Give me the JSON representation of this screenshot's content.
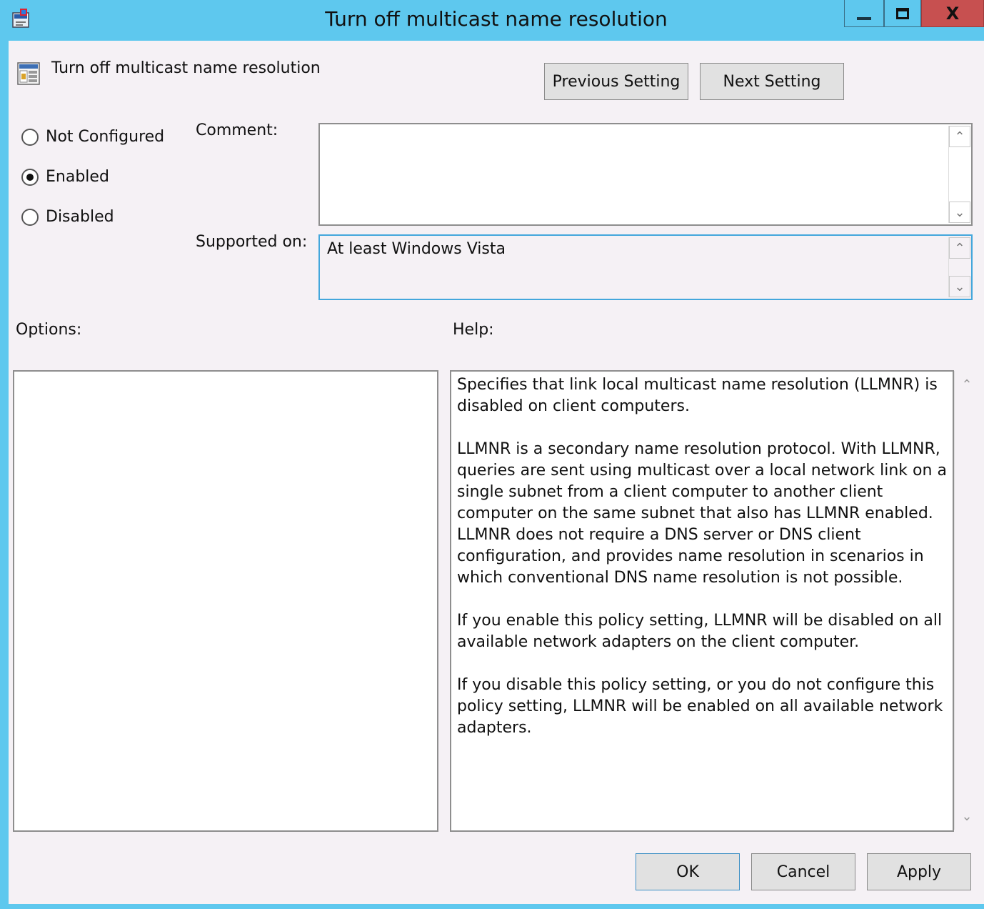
{
  "window": {
    "title": "Turn off multicast name resolution",
    "close_glyph": "X"
  },
  "header": {
    "policy_name": "Turn off multicast name resolution",
    "previous_label": "Previous Setting",
    "next_label": "Next Setting"
  },
  "state": {
    "options": [
      {
        "label": "Not Configured",
        "checked": false
      },
      {
        "label": "Enabled",
        "checked": true
      },
      {
        "label": "Disabled",
        "checked": false
      }
    ]
  },
  "fields": {
    "comment_label": "Comment:",
    "comment_value": "",
    "supported_label": "Supported on:",
    "supported_value": "At least Windows Vista"
  },
  "sections": {
    "options_label": "Options:",
    "help_label": "Help:"
  },
  "help": {
    "paragraphs": [
      "Specifies that link local multicast name resolution (LLMNR) is disabled on client computers.",
      "LLMNR is a secondary name resolution protocol. With LLMNR, queries are sent using multicast over a local network link on a single subnet from a client computer to another client computer on the same subnet that also has LLMNR enabled. LLMNR does not require a DNS server or DNS client configuration, and provides name resolution in scenarios in which conventional DNS name resolution is not possible.",
      "If you enable this policy setting, LLMNR will be disabled on all available network adapters on the client computer.",
      "If you disable this policy setting, or you do not configure this policy setting, LLMNR will be enabled on all available network adapters."
    ]
  },
  "footer": {
    "ok_label": "OK",
    "cancel_label": "Cancel",
    "apply_label": "Apply"
  },
  "icons": {
    "app": "group-policy-app-icon",
    "policy": "policy-setting-icon",
    "scroll_up": "chevron-up-icon",
    "scroll_down": "chevron-down-icon"
  },
  "colors": {
    "titlebar": "#5ec8ee",
    "close_button": "#c75050",
    "client_background": "#f5f1f5",
    "focus_border": "#43a7dc"
  }
}
